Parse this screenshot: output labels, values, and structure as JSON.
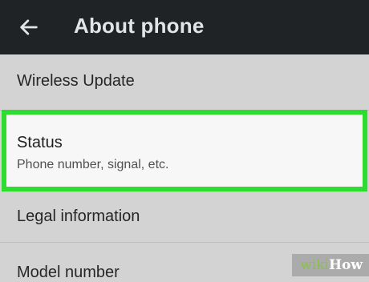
{
  "appbar": {
    "back_icon": "back-arrow-icon",
    "title": "About phone",
    "background": "#1f2326"
  },
  "settings_items": [
    {
      "title": "Wireless Update"
    },
    {
      "title": "Status",
      "subtitle": "Phone number, signal, etc.",
      "highlighted": true,
      "highlight_color": "#2edc2e"
    },
    {
      "title": "Legal information"
    },
    {
      "title": "Model number"
    }
  ],
  "watermark": {
    "prefix": "wiki",
    "suffix": "How"
  }
}
